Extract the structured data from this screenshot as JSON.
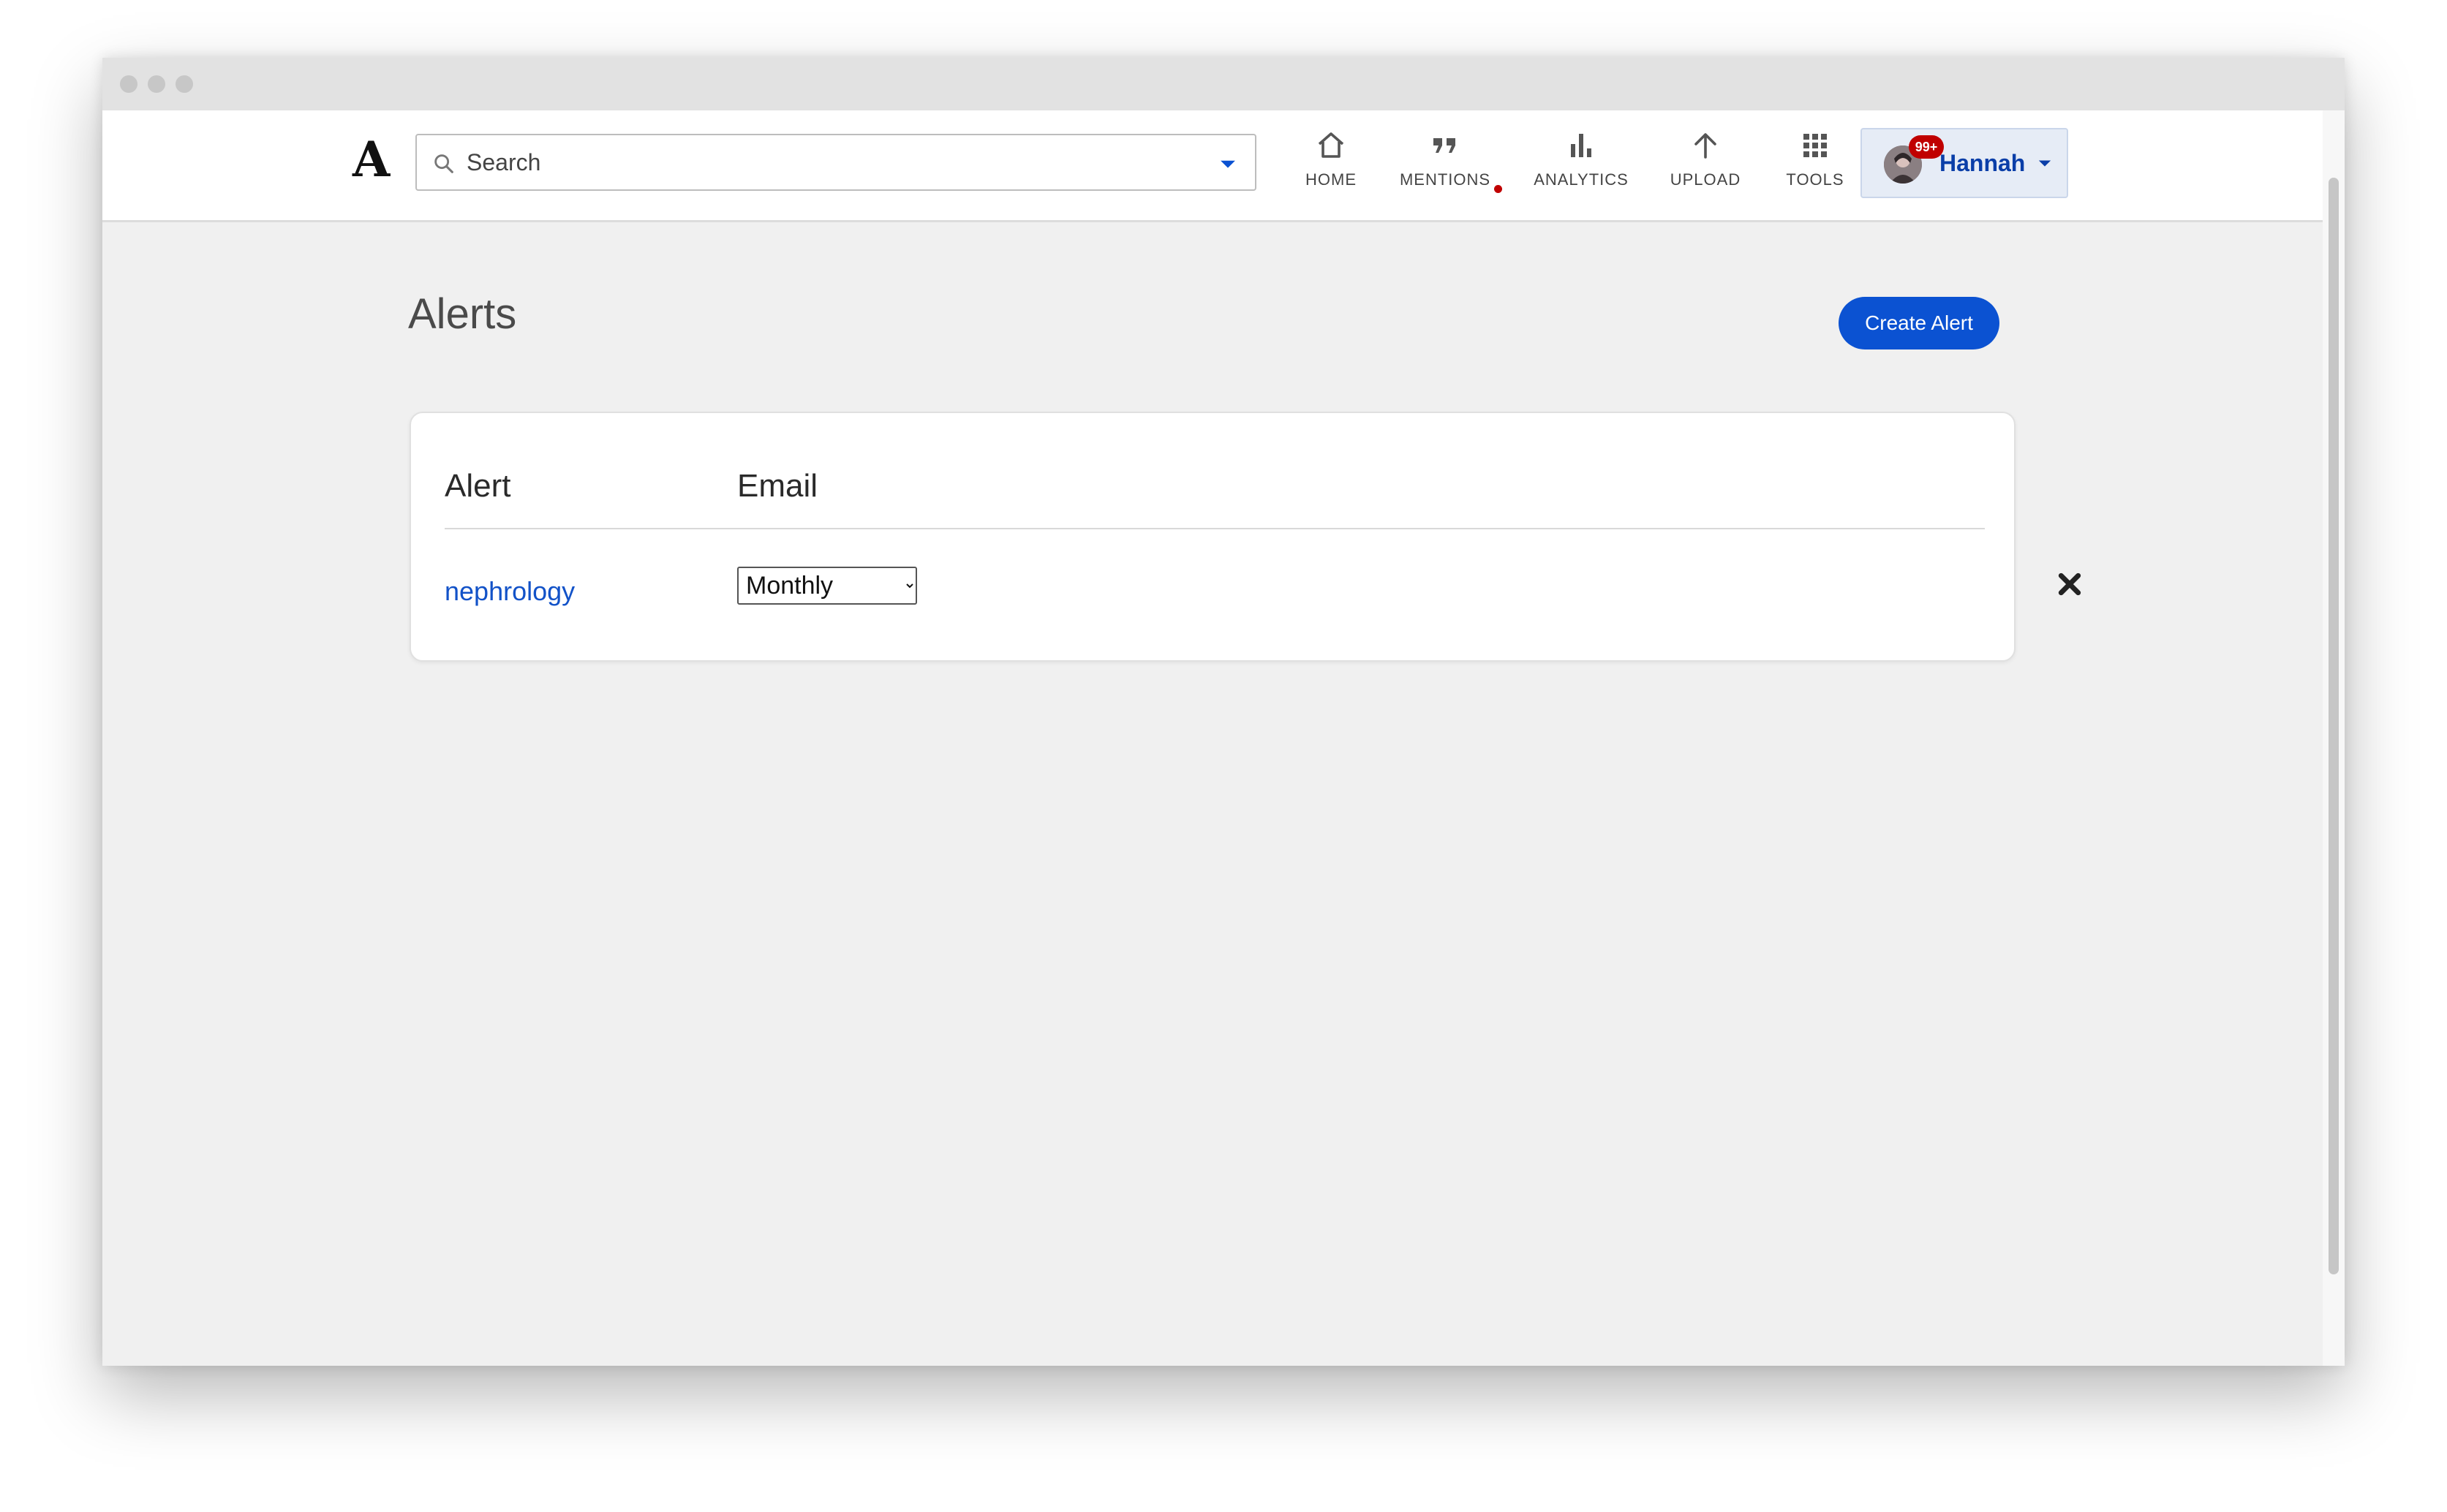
{
  "header": {
    "logo": "A",
    "search": {
      "placeholder": "Search",
      "value": ""
    },
    "nav": {
      "home": "HOME",
      "mentions": "MENTIONS",
      "analytics": "ANALYTICS",
      "upload": "UPLOAD",
      "tools": "TOOLS"
    },
    "user": {
      "name": "Hannah",
      "badge": "99+"
    }
  },
  "page": {
    "title": "Alerts",
    "create_button": "Create Alert"
  },
  "table": {
    "headers": {
      "alert": "Alert",
      "email": "Email"
    },
    "rows": [
      {
        "alert": "nephrology",
        "email_frequency": "Monthly"
      }
    ]
  },
  "colors": {
    "primary": "#0b52d2",
    "link": "#1252c8",
    "user_name": "#0a3ea8",
    "notification": "#c00000"
  },
  "icons": [
    "search-icon",
    "chevron-down-icon",
    "home-icon",
    "quote-icon",
    "bar-chart-icon",
    "arrow-up-icon",
    "grid-icon",
    "avatar",
    "close-icon"
  ]
}
